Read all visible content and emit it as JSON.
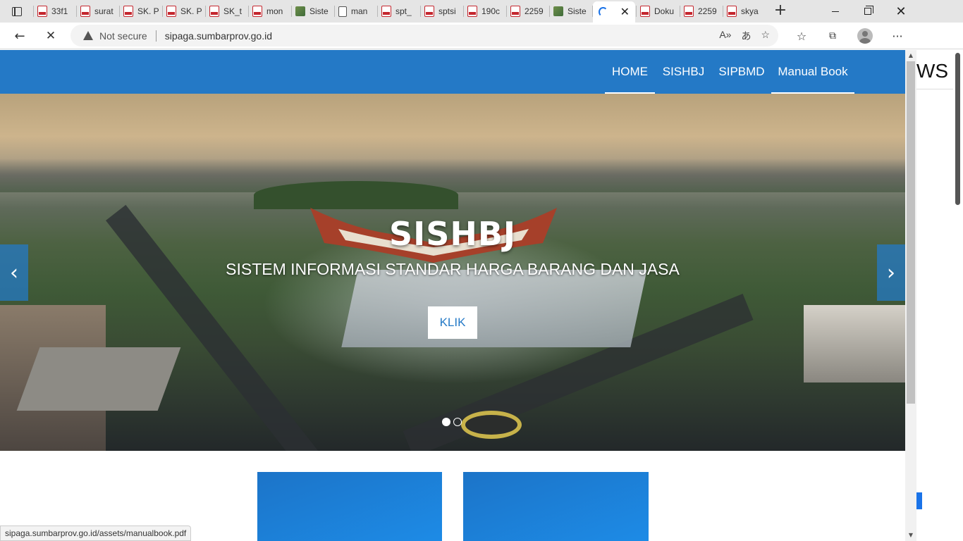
{
  "browser": {
    "tabs": [
      {
        "label": "33f1",
        "icon": "pdf-icon"
      },
      {
        "label": "surat",
        "icon": "pdf-icon"
      },
      {
        "label": "SK. P",
        "icon": "pdf-icon"
      },
      {
        "label": "SK. P",
        "icon": "pdf-icon"
      },
      {
        "label": "SK_t",
        "icon": "pdf-icon"
      },
      {
        "label": "mon",
        "icon": "pdf-icon"
      },
      {
        "label": "Siste",
        "icon": "site-icon"
      },
      {
        "label": "man",
        "icon": "document-icon"
      },
      {
        "label": "spt_",
        "icon": "pdf-icon"
      },
      {
        "label": "sptsi",
        "icon": "pdf-icon"
      },
      {
        "label": "190c",
        "icon": "pdf-icon"
      },
      {
        "label": "2259",
        "icon": "pdf-icon"
      },
      {
        "label": "Siste",
        "icon": "site-icon"
      },
      {
        "label": "",
        "icon": "loading-spinner-icon",
        "active": true
      },
      {
        "label": "Doku",
        "icon": "pdf-icon"
      },
      {
        "label": "2259",
        "icon": "pdf-icon"
      },
      {
        "label": "skya",
        "icon": "pdf-icon"
      }
    ],
    "new_tab_label": "+",
    "security_label": "Not secure",
    "url": "sipaga.sumbarprov.go.id",
    "status_url": "sipaga.sumbarprov.go.id/assets/manualbook.pdf",
    "side_peek_text": "WS",
    "side_panel_text": "WS"
  },
  "page": {
    "nav": [
      {
        "label": "HOME",
        "underlined": true
      },
      {
        "label": "SISHBJ",
        "underlined": false
      },
      {
        "label": "SIPBMD",
        "underlined": false
      },
      {
        "label": "Manual Book",
        "underlined": true
      }
    ],
    "hero": {
      "title": "SISHBJ",
      "subtitle": "SISTEM INFORMASI STANDAR HARGA BARANG DAN JASA",
      "button_label": "KLIK",
      "prev_label": "‹",
      "next_label": "›",
      "slides": 2,
      "active_slide": 1
    }
  },
  "colors": {
    "nav_background": "#2479c6",
    "card_blue": "#1d8be6"
  }
}
